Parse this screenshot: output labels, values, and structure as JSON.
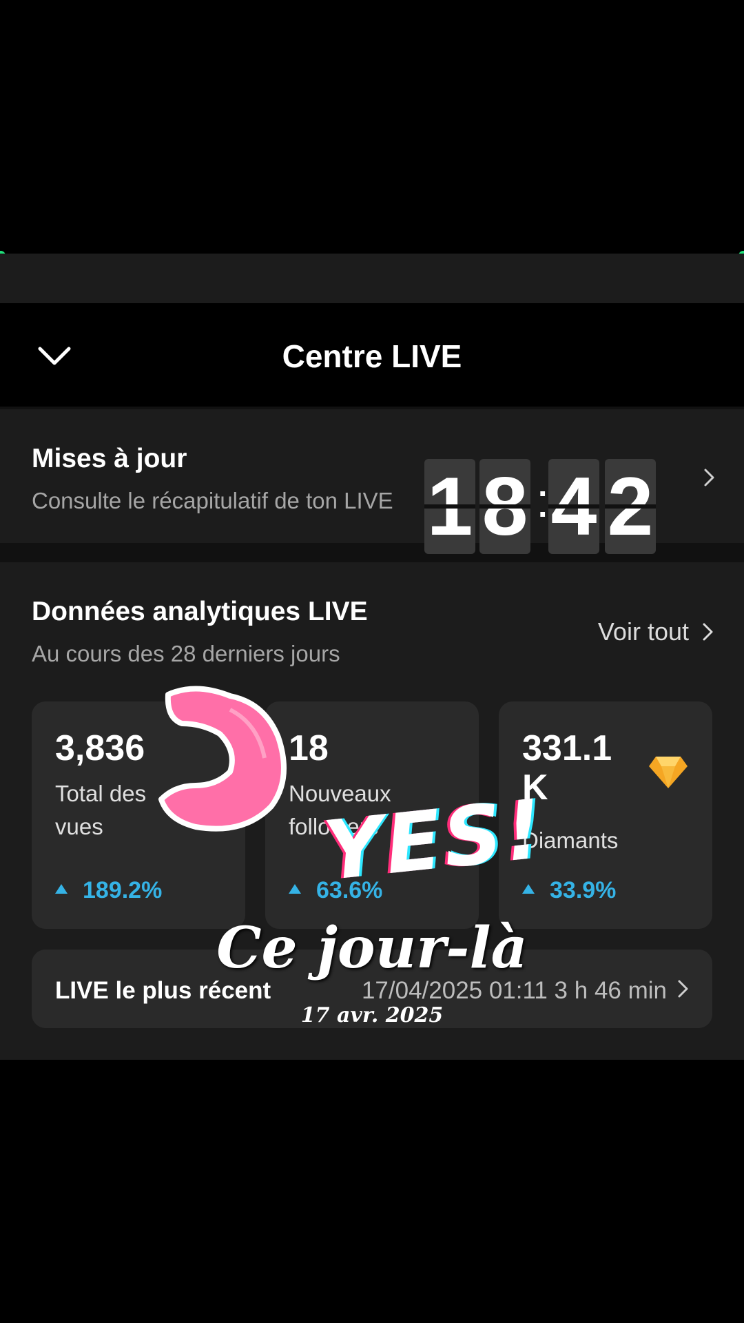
{
  "header": {
    "title": "Centre LIVE"
  },
  "updates": {
    "title": "Mises à jour",
    "subtitle": "Consulte le récapitulatif de ton LIVE"
  },
  "analytics": {
    "title": "Données analytiques LIVE",
    "subtitle": "Au cours des 28 derniers jours",
    "see_all": "Voir tout",
    "cards": [
      {
        "value": "3,836",
        "label_line1": "Total des",
        "label_line2": "vues",
        "delta": "189.2%"
      },
      {
        "value": "18",
        "label_line1": "Nouveaux",
        "label_line2": "followers",
        "delta": "63.6%"
      },
      {
        "value_line1": "331.1",
        "value_line2": "K",
        "label": "Diamants",
        "delta": "33.9%",
        "icon": "diamond-icon"
      }
    ]
  },
  "recent": {
    "label": "LIVE le plus récent",
    "info": "17/04/2025 01:11 3 h 46 min"
  },
  "overlay": {
    "clock_digits": [
      "1",
      "8",
      "4",
      "2"
    ],
    "sticker_text": "YES!",
    "caption": "Ce jour-là",
    "caption_date": "17 avr. 2025"
  },
  "colors": {
    "accent_blue": "#35b3e6",
    "panel_bg": "#1c1c1c",
    "card_bg": "#2a2a2a"
  }
}
